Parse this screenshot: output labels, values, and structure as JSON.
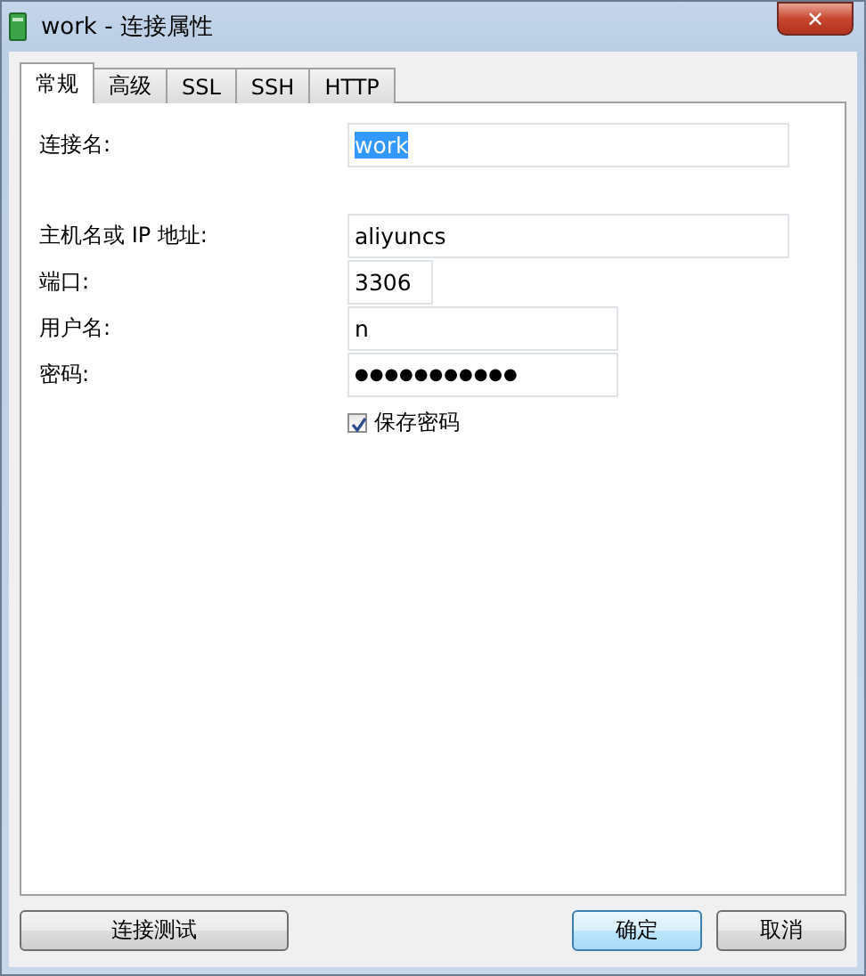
{
  "window": {
    "title": "work - 连接属性",
    "close": "✕"
  },
  "tabs": [
    {
      "label": "常规",
      "selected": true
    },
    {
      "label": "高级",
      "selected": false
    },
    {
      "label": "SSL",
      "selected": false
    },
    {
      "label": "SSH",
      "selected": false
    },
    {
      "label": "HTTP",
      "selected": false
    }
  ],
  "fields": [
    {
      "label": "连接名:",
      "value": "work",
      "selected": true,
      "kind": "wide"
    },
    {
      "label": "主机名或 IP 地址:",
      "value": "aliyuncs",
      "selected": false,
      "kind": "wide"
    },
    {
      "label": "端口:",
      "value": "3306",
      "selected": false,
      "kind": "short"
    },
    {
      "label": "用户名:",
      "value": "n",
      "selected": false,
      "kind": "medium"
    },
    {
      "label": "密码:",
      "value": "●●●●●●●●●●●",
      "selected": false,
      "kind": "password"
    }
  ],
  "save_password": {
    "label": "保存密码",
    "checked": true
  },
  "buttons": {
    "test": "连接测试",
    "ok": "确定",
    "cancel": "取消"
  }
}
